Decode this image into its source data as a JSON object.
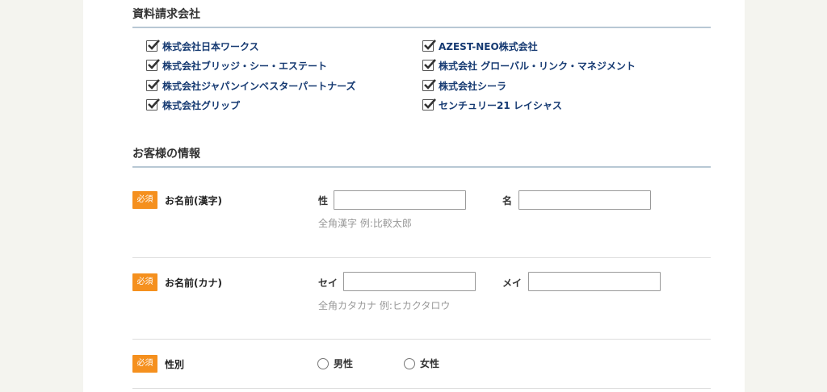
{
  "companies_section": {
    "title": "資料請求会社",
    "items": [
      {
        "label": "株式会社日本ワークス",
        "checked": true
      },
      {
        "label": "株式会社ブリッジ・シー・エステート",
        "checked": true
      },
      {
        "label": "株式会社ジャパンインベスターパートナーズ",
        "checked": true
      },
      {
        "label": "株式会社グリップ",
        "checked": true
      },
      {
        "label": "AZEST-NEO株式会社",
        "checked": true
      },
      {
        "label": "株式会社 グローバル・リンク・マネジメント",
        "checked": true
      },
      {
        "label": "株式会社シーラ",
        "checked": true
      },
      {
        "label": "センチュリー21 レイシャス",
        "checked": true
      }
    ]
  },
  "customer_section": {
    "title": "お客様の情報",
    "required_badge": "必須",
    "name_kanji": {
      "label": "お名前(漢字)",
      "last_label": "性",
      "first_label": "名",
      "last_value": "",
      "first_value": "",
      "hint": "全角漢字 例:比較太郎"
    },
    "name_kana": {
      "label": "お名前(カナ)",
      "last_label": "セイ",
      "first_label": "メイ",
      "last_value": "",
      "first_value": "",
      "hint": "全角カタカナ 例:ヒカクタロウ"
    },
    "gender": {
      "label": "性別",
      "options": [
        "男性",
        "女性"
      ]
    }
  },
  "colors": {
    "page_bg": "#f4f4ef",
    "panel_bg": "#ffffff",
    "link_text": "#163a72",
    "required_badge": "#f5901e",
    "section_rule": "#b8c8d4"
  }
}
